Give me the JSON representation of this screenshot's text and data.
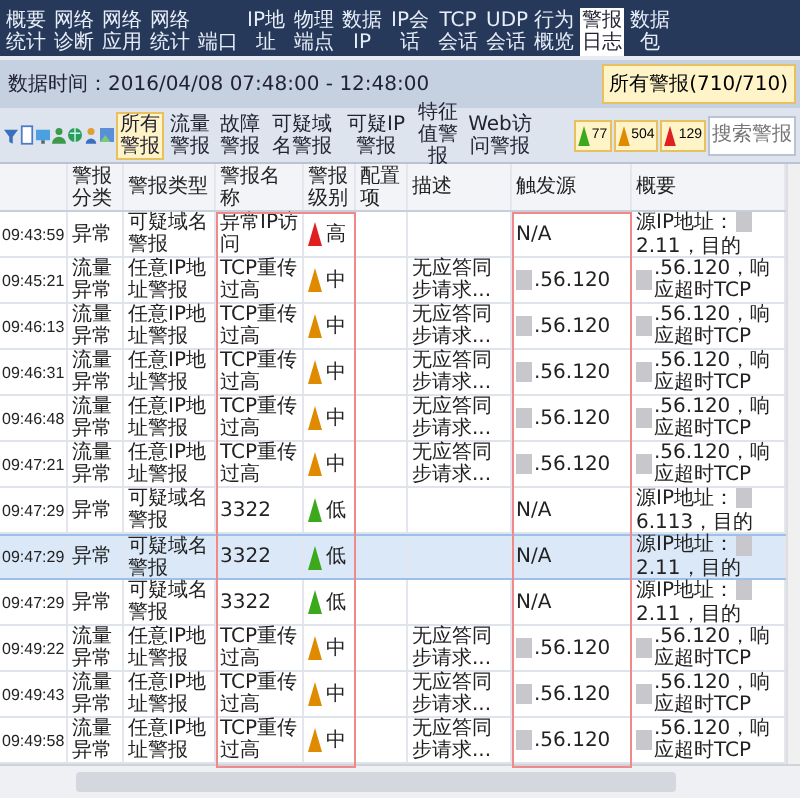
{
  "tabs": [
    {
      "label": "概要统计",
      "selected": false
    },
    {
      "label": "网络诊断",
      "selected": false
    },
    {
      "label": "网络应用",
      "selected": false
    },
    {
      "label": "网络统计",
      "selected": false
    },
    {
      "label": "端口",
      "selected": false
    },
    {
      "label": "IP地址",
      "selected": false
    },
    {
      "label": "物理端点",
      "selected": false
    },
    {
      "label": "数据IP",
      "selected": false
    },
    {
      "label": "IP会话",
      "selected": false
    },
    {
      "label": "TCP会话",
      "selected": false
    },
    {
      "label": "UDP会话",
      "selected": false
    },
    {
      "label": "行为概览",
      "selected": false
    },
    {
      "label": "警报日志",
      "selected": true
    },
    {
      "label": "数据包",
      "selected": false
    }
  ],
  "info": {
    "time_range": "数据时间：2016/04/08 07:48:00 - 12:48:00",
    "all_button": "所有警报(710/710)"
  },
  "filters": [
    {
      "label": "所有警报",
      "selected": true
    },
    {
      "label": "流量警报",
      "selected": false
    },
    {
      "label": "故障警报",
      "selected": false
    },
    {
      "label": "可疑域名警报",
      "selected": false
    },
    {
      "label": "可疑IP警报",
      "selected": false
    },
    {
      "label": "特征值警报",
      "selected": false
    },
    {
      "label": "Web访问警报",
      "selected": false
    }
  ],
  "counts": [
    {
      "color": "#3ca81c",
      "count": "77"
    },
    {
      "color": "#e08a00",
      "count": "504"
    },
    {
      "color": "#e02020",
      "count": "129"
    }
  ],
  "search": {
    "placeholder": "搜索警报"
  },
  "table": {
    "columns": [
      "警报分类",
      "警报类型",
      "警报名称",
      "警报级别",
      "配置项",
      "描述",
      "触发源",
      "概要"
    ],
    "rows": [
      {
        "time": "09:43:59",
        "category": "异常",
        "type": "可疑域名警报",
        "name": "异常IP访问",
        "color": "#e02020",
        "severity_label": "高",
        "source": [
          {
            "kind": "text",
            "text": "N/A"
          }
        ],
        "summary": [
          {
            "kind": "text",
            "text": "源IP地址："
          },
          {
            "kind": "redaction"
          },
          {
            "kind": "text",
            "text": "2.11，目的"
          }
        ],
        "selected": false
      },
      {
        "time": "09:45:21",
        "category": "流量异常",
        "type": "任意IP地址警报",
        "name": "TCP重传过高",
        "color": "#e08a00",
        "severity_label": "中",
        "description": "无应答同步请求...",
        "source": [
          {
            "kind": "redaction"
          },
          {
            "kind": "text",
            "text": ".56.120"
          }
        ],
        "summary": [
          {
            "kind": "redaction"
          },
          {
            "kind": "text",
            "text": ".56.120，响应超时TCP"
          }
        ],
        "selected": false
      },
      {
        "time": "09:46:13",
        "category": "流量异常",
        "type": "任意IP地址警报",
        "name": "TCP重传过高",
        "color": "#e08a00",
        "severity_label": "中",
        "description": "无应答同步请求...",
        "source": [
          {
            "kind": "redaction"
          },
          {
            "kind": "text",
            "text": ".56.120"
          }
        ],
        "summary": [
          {
            "kind": "redaction"
          },
          {
            "kind": "text",
            "text": ".56.120，响应超时TCP"
          }
        ],
        "selected": false
      },
      {
        "time": "09:46:31",
        "category": "流量异常",
        "type": "任意IP地址警报",
        "name": "TCP重传过高",
        "color": "#e08a00",
        "severity_label": "中",
        "description": "无应答同步请求...",
        "source": [
          {
            "kind": "redaction"
          },
          {
            "kind": "text",
            "text": ".56.120"
          }
        ],
        "summary": [
          {
            "kind": "redaction"
          },
          {
            "kind": "text",
            "text": ".56.120，响应超时TCP"
          }
        ],
        "selected": false
      },
      {
        "time": "09:46:48",
        "category": "流量异常",
        "type": "任意IP地址警报",
        "name": "TCP重传过高",
        "color": "#e08a00",
        "severity_label": "中",
        "description": "无应答同步请求...",
        "source": [
          {
            "kind": "redaction"
          },
          {
            "kind": "text",
            "text": ".56.120"
          }
        ],
        "summary": [
          {
            "kind": "redaction"
          },
          {
            "kind": "text",
            "text": ".56.120，响应超时TCP"
          }
        ],
        "selected": false
      },
      {
        "time": "09:47:21",
        "category": "流量异常",
        "type": "任意IP地址警报",
        "name": "TCP重传过高",
        "color": "#e08a00",
        "severity_label": "中",
        "description": "无应答同步请求...",
        "source": [
          {
            "kind": "redaction"
          },
          {
            "kind": "text",
            "text": ".56.120"
          }
        ],
        "summary": [
          {
            "kind": "redaction"
          },
          {
            "kind": "text",
            "text": ".56.120，响应超时TCP"
          }
        ],
        "selected": false
      },
      {
        "time": "09:47:29",
        "category": "异常",
        "type": "可疑域名警报",
        "name": "3322",
        "color": "#3ca81c",
        "severity_label": "低",
        "source": [
          {
            "kind": "text",
            "text": "N/A"
          }
        ],
        "summary": [
          {
            "kind": "text",
            "text": "源IP地址："
          },
          {
            "kind": "redaction"
          },
          {
            "kind": "text",
            "text": "6.113，目的"
          }
        ],
        "selected": false
      },
      {
        "time": "09:47:29",
        "category": "异常",
        "type": "可疑域名警报",
        "name": "3322",
        "color": "#3ca81c",
        "severity_label": "低",
        "source": [
          {
            "kind": "text",
            "text": "N/A"
          }
        ],
        "summary": [
          {
            "kind": "text",
            "text": "源IP地址："
          },
          {
            "kind": "redaction"
          },
          {
            "kind": "text",
            "text": "2.11，目的"
          }
        ],
        "selected": true
      },
      {
        "time": "09:47:29",
        "category": "异常",
        "type": "可疑域名警报",
        "name": "3322",
        "color": "#3ca81c",
        "severity_label": "低",
        "source": [
          {
            "kind": "text",
            "text": "N/A"
          }
        ],
        "summary": [
          {
            "kind": "text",
            "text": "源IP地址："
          },
          {
            "kind": "redaction"
          },
          {
            "kind": "text",
            "text": "2.11，目的"
          }
        ],
        "selected": false
      },
      {
        "time": "09:49:22",
        "category": "流量异常",
        "type": "任意IP地址警报",
        "name": "TCP重传过高",
        "color": "#e08a00",
        "severity_label": "中",
        "description": "无应答同步请求...",
        "source": [
          {
            "kind": "redaction"
          },
          {
            "kind": "text",
            "text": ".56.120"
          }
        ],
        "summary": [
          {
            "kind": "redaction"
          },
          {
            "kind": "text",
            "text": ".56.120，响应超时TCP"
          }
        ],
        "selected": false
      },
      {
        "time": "09:49:43",
        "category": "流量异常",
        "type": "任意IP地址警报",
        "name": "TCP重传过高",
        "color": "#e08a00",
        "severity_label": "中",
        "description": "无应答同步请求...",
        "source": [
          {
            "kind": "redaction"
          },
          {
            "kind": "text",
            "text": ".56.120"
          }
        ],
        "summary": [
          {
            "kind": "redaction"
          },
          {
            "kind": "text",
            "text": ".56.120，响应超时TCP"
          }
        ],
        "selected": false
      },
      {
        "time": "09:49:58",
        "category": "流量异常",
        "type": "任意IP地址警报",
        "name": "TCP重传过高",
        "color": "#e08a00",
        "severity_label": "中",
        "description": "无应答同步请求...",
        "source": [
          {
            "kind": "redaction"
          },
          {
            "kind": "text",
            "text": ".56.120"
          }
        ],
        "summary": [
          {
            "kind": "redaction"
          },
          {
            "kind": "text",
            "text": ".56.120，响应超时TCP"
          }
        ],
        "selected": false
      }
    ]
  }
}
